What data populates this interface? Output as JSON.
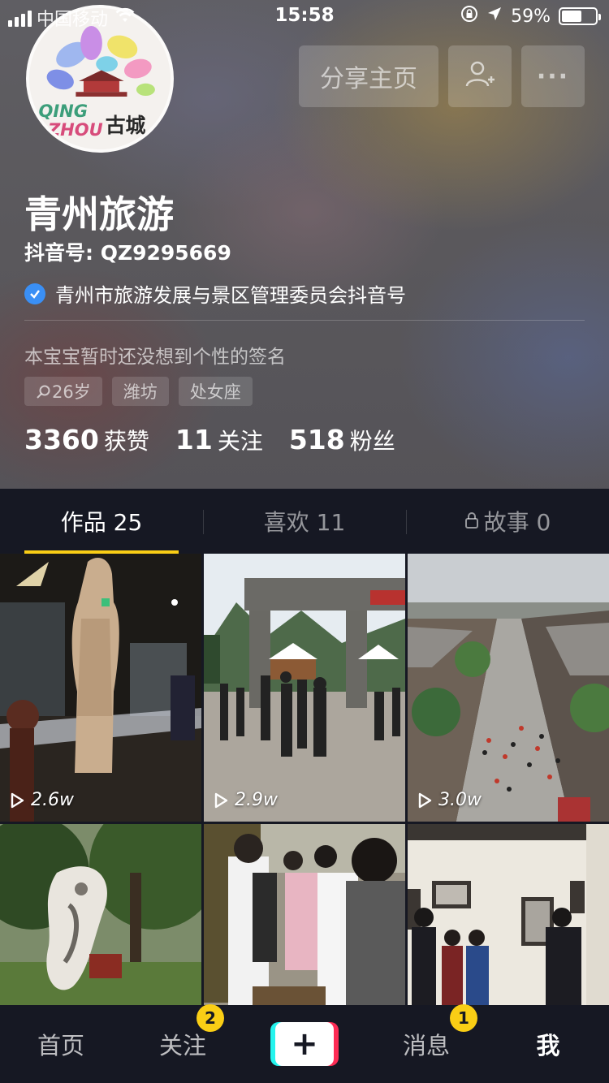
{
  "status_bar": {
    "carrier": "中国移动",
    "time": "15:58",
    "battery": "59%",
    "battery_level": 0.59
  },
  "header": {
    "share_button": "分享主页",
    "more_button": "···",
    "profile_name": "青州旅游",
    "douyin_id": "抖音号: QZ9295669",
    "verification": "青州市旅游发展与景区管理委员会抖音号",
    "signature": "本宝宝暂时还没想到个性的签名",
    "tags": [
      "26岁",
      "潍坊",
      "处女座"
    ]
  },
  "stats": [
    {
      "value": "3360",
      "label": "获赞"
    },
    {
      "value": "11",
      "label": "关注"
    },
    {
      "value": "518",
      "label": "粉丝"
    }
  ],
  "tabs": [
    {
      "label": "作品 25",
      "active": true
    },
    {
      "label": "喜欢 11",
      "active": false
    },
    {
      "label": "故事 0",
      "active": false,
      "icon": "lock-icon"
    }
  ],
  "videos": [
    {
      "plays": "2.6w"
    },
    {
      "plays": "2.9w"
    },
    {
      "plays": "3.0w"
    },
    {
      "plays": ""
    },
    {
      "plays": ""
    },
    {
      "plays": ""
    }
  ],
  "nav": {
    "home": "首页",
    "follow": "关注",
    "follow_badge": "2",
    "create": "+",
    "messages": "消息",
    "messages_badge": "1",
    "me": "我"
  },
  "colors": {
    "accent": "#face15",
    "background": "#161823",
    "verify": "#3a8ff5",
    "plus_cyan": "#25f4ee",
    "plus_red": "#fe2c55"
  }
}
